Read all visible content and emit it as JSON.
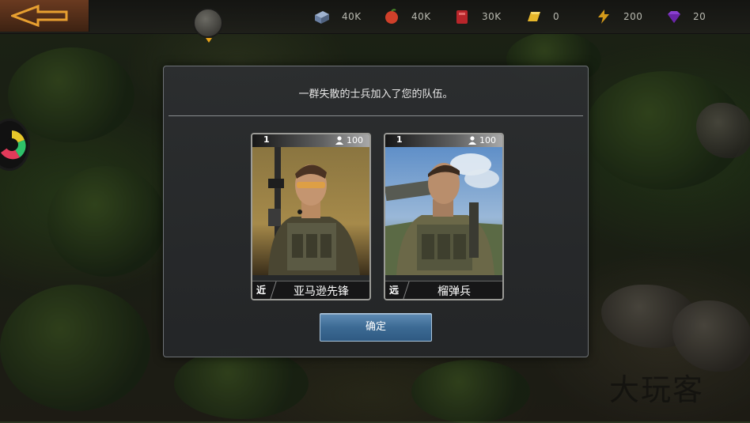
{
  "resources": [
    {
      "icon": "supply-crate-icon",
      "value": "40K",
      "color": "#7f95b8"
    },
    {
      "icon": "food-icon",
      "value": "40K",
      "color": "#d0402a"
    },
    {
      "icon": "fuel-icon",
      "value": "30K",
      "color": "#b8252a"
    },
    {
      "icon": "gold-bar-icon",
      "value": "0",
      "color": "#e6b62a"
    },
    {
      "icon": "energy-bolt-icon",
      "value": "200",
      "color": "#d49a1a"
    },
    {
      "icon": "diamond-icon",
      "value": "20",
      "color": "#8a3fd0"
    }
  ],
  "dialog": {
    "message": "一群失散的士兵加入了您的队伍。",
    "confirm_label": "确定"
  },
  "cards": [
    {
      "level": "1",
      "capacity": "100",
      "range_type": "近",
      "name": "亚马逊先锋",
      "art": "soldier-portrait-vanguard"
    },
    {
      "level": "1",
      "capacity": "100",
      "range_type": "远",
      "name": "榴弹兵",
      "art": "soldier-portrait-grenadier"
    }
  ],
  "watermark": "大玩客",
  "colors": {
    "accent_button": "#3c6a94",
    "dialog_bg": "#2c2e30"
  }
}
